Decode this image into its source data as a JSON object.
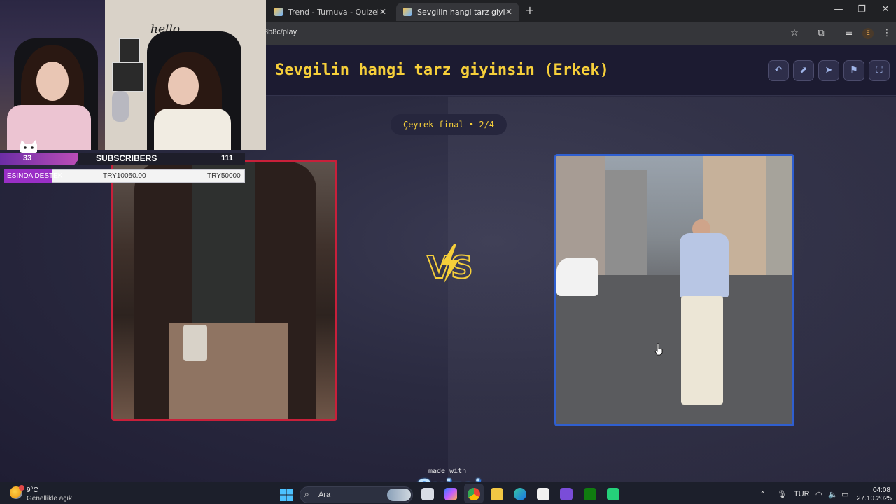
{
  "browser": {
    "tabs": [
      {
        "title": "Trend - Turnuva - Quizei",
        "close": "✕"
      },
      {
        "title": "Sevgilin hangi tarz giyinsin (Erke",
        "close": "✕"
      }
    ],
    "new_tab": "+",
    "window_controls": {
      "minimize": "—",
      "restore": "❐",
      "close": "✕"
    },
    "url": "3b8c/play",
    "profile_initial": "E"
  },
  "quiz": {
    "title": "Sevgilin hangi tarz giyinsin (Erkek)",
    "round_label": "Çeyrek final • 2/4",
    "vs_text": "VS",
    "made_with": "made with",
    "brand": "Quizei",
    "left_border_color": "#c8203a",
    "right_border_color": "#2f5fd0",
    "accent_color": "#f6cf3a"
  },
  "stream_overlay": {
    "webcam_sign": "hello",
    "sub_count": "33",
    "sub_label": "SUBSCRIBERS",
    "sub_total": "111",
    "goal_name": "ESİNDA DESTEK",
    "goal_current": "TRY10050.00",
    "goal_target": "TRY50000",
    "goal_progress": 0.2
  },
  "taskbar": {
    "temperature": "9°C",
    "condition": "Genellikle açık",
    "search_placeholder": "Ara",
    "language": "TUR",
    "time": "04:08",
    "date": "27.10.2025"
  }
}
